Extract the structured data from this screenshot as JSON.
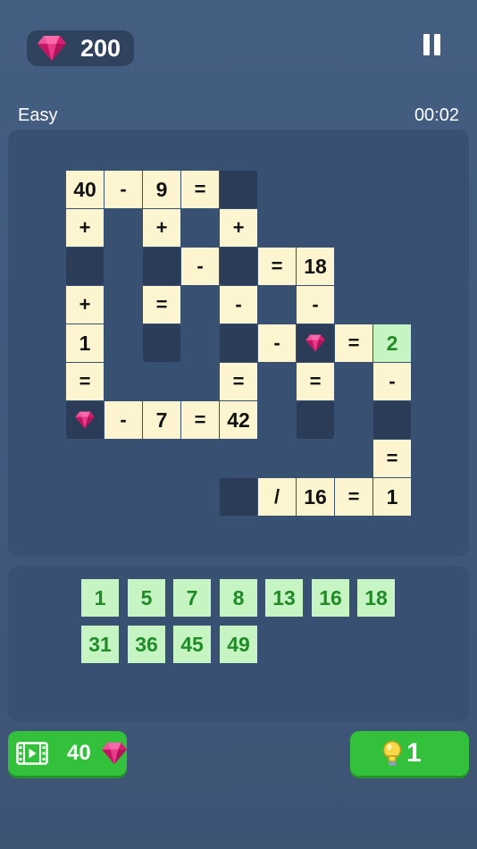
{
  "header": {
    "gem_count": "200",
    "difficulty": "Easy",
    "timer": "00:02"
  },
  "board": {
    "cells": [
      {
        "id": "r0c0",
        "text": "40",
        "kind": "num"
      },
      {
        "id": "r0c1",
        "text": "-",
        "kind": "op"
      },
      {
        "id": "r0c2",
        "text": "9",
        "kind": "num"
      },
      {
        "id": "r0c3",
        "text": "=",
        "kind": "op"
      },
      {
        "id": "r0c4",
        "text": "",
        "kind": "blank"
      },
      {
        "id": "r1c0",
        "text": "+",
        "kind": "op"
      },
      {
        "id": "r1c2",
        "text": "+",
        "kind": "op"
      },
      {
        "id": "r1c4",
        "text": "+",
        "kind": "op"
      },
      {
        "id": "r2c0",
        "text": "",
        "kind": "blank"
      },
      {
        "id": "r2c2",
        "text": "",
        "kind": "blank"
      },
      {
        "id": "r2c3",
        "text": "-",
        "kind": "op"
      },
      {
        "id": "r2c4",
        "text": "",
        "kind": "blank"
      },
      {
        "id": "r2c5",
        "text": "=",
        "kind": "op"
      },
      {
        "id": "r2c6",
        "text": "18",
        "kind": "num"
      },
      {
        "id": "r3c0",
        "text": "+",
        "kind": "op"
      },
      {
        "id": "r3c2",
        "text": "=",
        "kind": "op"
      },
      {
        "id": "r3c4",
        "text": "-",
        "kind": "op"
      },
      {
        "id": "r3c6",
        "text": "-",
        "kind": "op"
      },
      {
        "id": "r4c0",
        "text": "1",
        "kind": "num"
      },
      {
        "id": "r4c2",
        "text": "",
        "kind": "blank"
      },
      {
        "id": "r4c4",
        "text": "",
        "kind": "blank"
      },
      {
        "id": "r4c5",
        "text": "-",
        "kind": "op"
      },
      {
        "id": "r4c6",
        "text": "",
        "kind": "gem-blank"
      },
      {
        "id": "r4c7",
        "text": "=",
        "kind": "op"
      },
      {
        "id": "r4c8",
        "text": "2",
        "kind": "filled"
      },
      {
        "id": "r5c0",
        "text": "=",
        "kind": "op"
      },
      {
        "id": "r5c4",
        "text": "=",
        "kind": "op"
      },
      {
        "id": "r5c6",
        "text": "=",
        "kind": "op"
      },
      {
        "id": "r5c8",
        "text": "-",
        "kind": "op"
      },
      {
        "id": "r6c0",
        "text": "",
        "kind": "gem-blank"
      },
      {
        "id": "r6c1",
        "text": "-",
        "kind": "op"
      },
      {
        "id": "r6c2",
        "text": "7",
        "kind": "num"
      },
      {
        "id": "r6c3",
        "text": "=",
        "kind": "op"
      },
      {
        "id": "r6c4",
        "text": "42",
        "kind": "num"
      },
      {
        "id": "r6c6",
        "text": "",
        "kind": "blank"
      },
      {
        "id": "r6c8",
        "text": "",
        "kind": "blank"
      },
      {
        "id": "r7c8",
        "text": "=",
        "kind": "op"
      },
      {
        "id": "r8c4",
        "text": "",
        "kind": "blank"
      },
      {
        "id": "r8c5",
        "text": "/",
        "kind": "op"
      },
      {
        "id": "r8c6",
        "text": "16",
        "kind": "num"
      },
      {
        "id": "r8c7",
        "text": "=",
        "kind": "op"
      },
      {
        "id": "r8c8",
        "text": "1",
        "kind": "num"
      }
    ]
  },
  "tray": {
    "tiles": [
      "1",
      "5",
      "7",
      "8",
      "13",
      "16",
      "18",
      "31",
      "36",
      "45",
      "49"
    ]
  },
  "footer": {
    "video_cost": "40",
    "hint_count": "1"
  },
  "colors": {
    "background": "#445e82",
    "panel": "#385072",
    "cell": "#fcf5d0",
    "blank": "#2b3c58",
    "tile": "#c6f4c3",
    "tile_text": "#1f8c26",
    "button": "#33c13b",
    "gem": "#e0287a"
  },
  "icons": {
    "currency": "gem-icon",
    "pause": "pause-icon",
    "video": "film-icon",
    "hint": "lightbulb-icon"
  }
}
